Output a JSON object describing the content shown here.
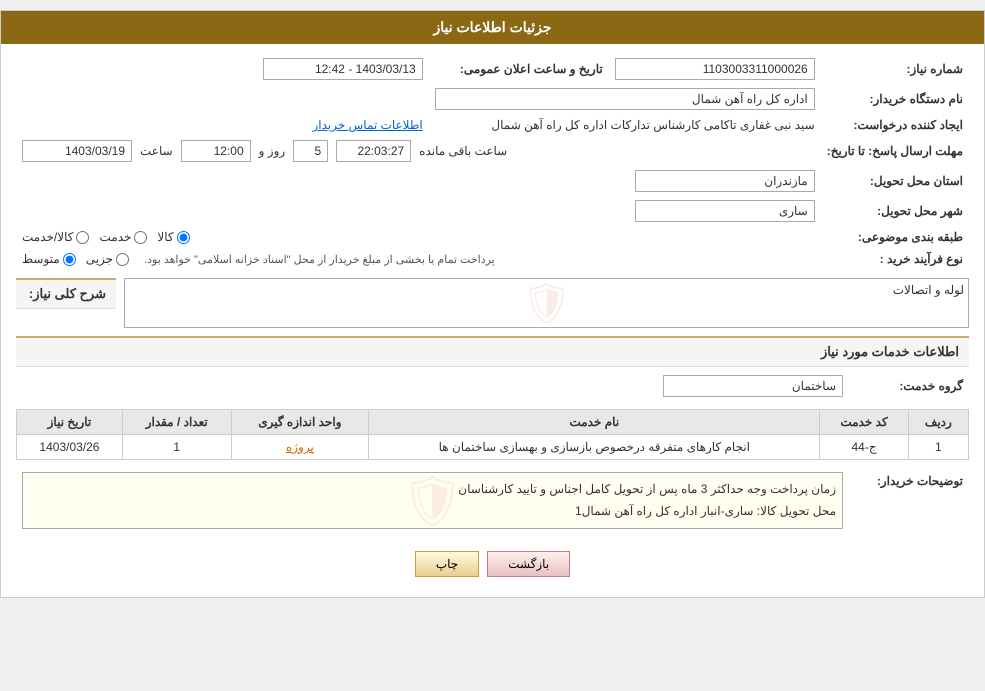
{
  "header": {
    "title": "جزئیات اطلاعات نیاز"
  },
  "fields": {
    "shomareNiaz_label": "شماره نیاز:",
    "shomareNiaz_value": "1103003311000026",
    "namDastgah_label": "نام دستگاه خریدار:",
    "namDastgah_value": "اداره کل راه آهن شمال",
    "tarikh_label": "تاریخ و ساعت اعلان عمومی:",
    "tarikh_value": "1403/03/13 - 12:42",
    "ijadKonande_label": "ایجاد کننده درخواست:",
    "ijadKonande_value": "سید نبی غفاری تاکامی کارشناس تدارکات اداره کل راه آهن شمال",
    "ittilaat_link": "اطلاعات تماس خریدار",
    "mohlat_label": "مهلت ارسال پاسخ: تا تاریخ:",
    "mohlat_date": "1403/03/19",
    "mohlat_saat_label": "ساعت",
    "mohlat_saat_value": "12:00",
    "mohlat_rooz_label": "روز و",
    "mohlat_rooz_value": "5",
    "mohlat_baqi_label": "ساعت باقی مانده",
    "mohlat_baqi_value": "22:03:27",
    "ostan_label": "استان محل تحویل:",
    "ostan_value": "مازندران",
    "shahr_label": "شهر محل تحویل:",
    "shahr_value": "ساری",
    "tabaqe_label": "طبقه بندی موضوعی:",
    "tabaqe_options": [
      "کالا",
      "خدمت",
      "کالا/خدمت"
    ],
    "tabaqe_selected": "کالا",
    "noeFarayand_label": "نوع فرآیند خرید :",
    "noeFarayand_options": [
      "جزیی",
      "متوسط"
    ],
    "noeFarayand_selected": "متوسط",
    "noeFarayand_note": "پرداخت تمام یا بخشی از مبلغ خریدار از محل \"اسناد خزانه اسلامی\" خواهد بود.",
    "sharh_label": "شرح کلی نیاز:",
    "sharh_value": "لوله و اتصالات",
    "khadamat_label": "اطلاعات خدمات مورد نیاز",
    "goroh_label": "گروه خدمت:",
    "goroh_value": "ساختمان",
    "table": {
      "headers": [
        "ردیف",
        "کد خدمت",
        "نام خدمت",
        "واحد اندازه گیری",
        "تعداد / مقدار",
        "تاریخ نیاز"
      ],
      "rows": [
        {
          "radif": "1",
          "kod": "ج-44",
          "nam": "انجام کارهای متفرقه درخصوص بازسازی و بهسازی ساختمان ها",
          "vahed": "پروژه",
          "tedad": "1",
          "tarikh": "1403/03/26"
        }
      ]
    },
    "tawzihat_label": "توضیحات خریدار:",
    "tawzihat_value": "زمان پرداخت وجه حداکثر 3 ماه پس از تحویل کامل اجناس و تایید کارشناسان\nمحل تحویل کالا: ساری-انبار اداره کل راه آهن شمال1"
  },
  "buttons": {
    "print": "چاپ",
    "back": "بازگشت"
  }
}
